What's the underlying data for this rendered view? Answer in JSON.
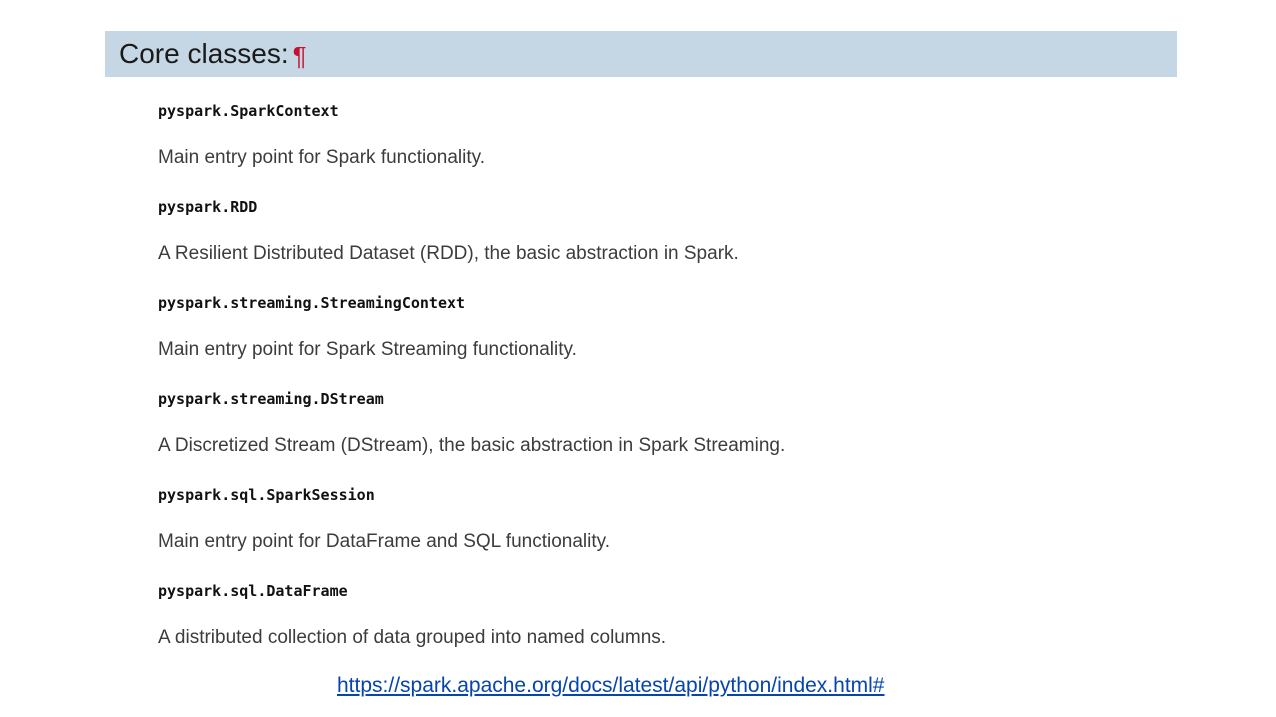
{
  "section": {
    "title": "Core classes:",
    "anchor_symbol": "¶"
  },
  "entries": [
    {
      "name": "pyspark.SparkContext",
      "description": "Main entry point for Spark functionality."
    },
    {
      "name": "pyspark.RDD",
      "description": "A Resilient Distributed Dataset (RDD), the basic abstraction in Spark."
    },
    {
      "name": "pyspark.streaming.StreamingContext",
      "description": "Main entry point for Spark Streaming functionality."
    },
    {
      "name": "pyspark.streaming.DStream",
      "description": "A Discretized Stream (DStream), the basic abstraction in Spark Streaming."
    },
    {
      "name": "pyspark.sql.SparkSession",
      "description": "Main entry point for DataFrame and SQL functionality."
    },
    {
      "name": "pyspark.sql.DataFrame",
      "description": "A distributed collection of data grouped into named columns."
    }
  ],
  "source_link": {
    "text": "https://spark.apache.org/docs/latest/api/python/index.html#"
  },
  "colors": {
    "header_background": "#c5d7e5",
    "anchor_symbol": "#c8102e",
    "link": "#0645ad"
  }
}
